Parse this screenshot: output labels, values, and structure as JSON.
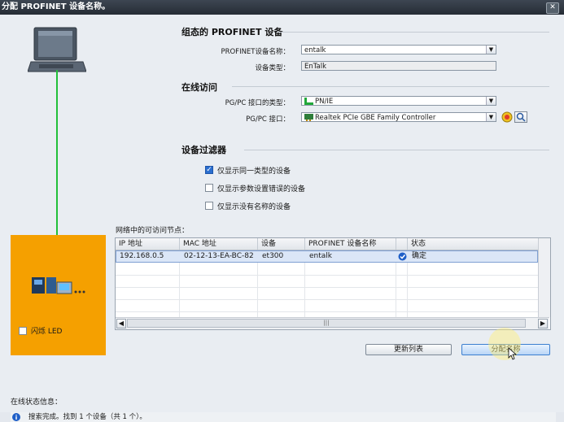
{
  "window": {
    "title": "分配 PROFINET 设备名称。",
    "close_label": "✕"
  },
  "configured": {
    "heading": "组态的 PROFINET 设备",
    "name_label": "PROFINET设备名称：",
    "name_value": "entalk",
    "type_label": "设备类型：",
    "type_value": "EnTalk"
  },
  "online": {
    "heading": "在线访问",
    "iface_type_label": "PG/PC 接口的类型：",
    "iface_type_value": "PN/IE",
    "iface_label": "PG/PC 接口：",
    "iface_value": "Realtek PCIe GBE Family Controller"
  },
  "filter": {
    "heading": "设备过滤器",
    "options": [
      {
        "label": "仅显示同一类型的设备",
        "checked": true
      },
      {
        "label": "仅显示参数设置错误的设备",
        "checked": false
      },
      {
        "label": "仅显示没有名称的设备",
        "checked": false
      }
    ]
  },
  "led": {
    "label": "闪烁 LED"
  },
  "nodes": {
    "heading": "网络中的可访问节点：",
    "columns": [
      "IP 地址",
      "MAC 地址",
      "设备",
      "PROFINET 设备名称",
      "状态"
    ],
    "rows": [
      {
        "ip": "192.168.0.5",
        "mac": "02-12-13-EA-BC-82",
        "device": "et300",
        "name": "entalk",
        "status": "确定"
      }
    ],
    "scroll_mid": "|||"
  },
  "buttons": {
    "refresh": "更新列表",
    "assign": "分配名称"
  },
  "status": {
    "heading": "在线状态信息：",
    "message": "搜索完成。找到 1 个设备（共 1 个）。"
  },
  "colors": {
    "accent": "#2a6ecf",
    "orange_panel": "#f5a000",
    "link_line": "#22c03a"
  }
}
